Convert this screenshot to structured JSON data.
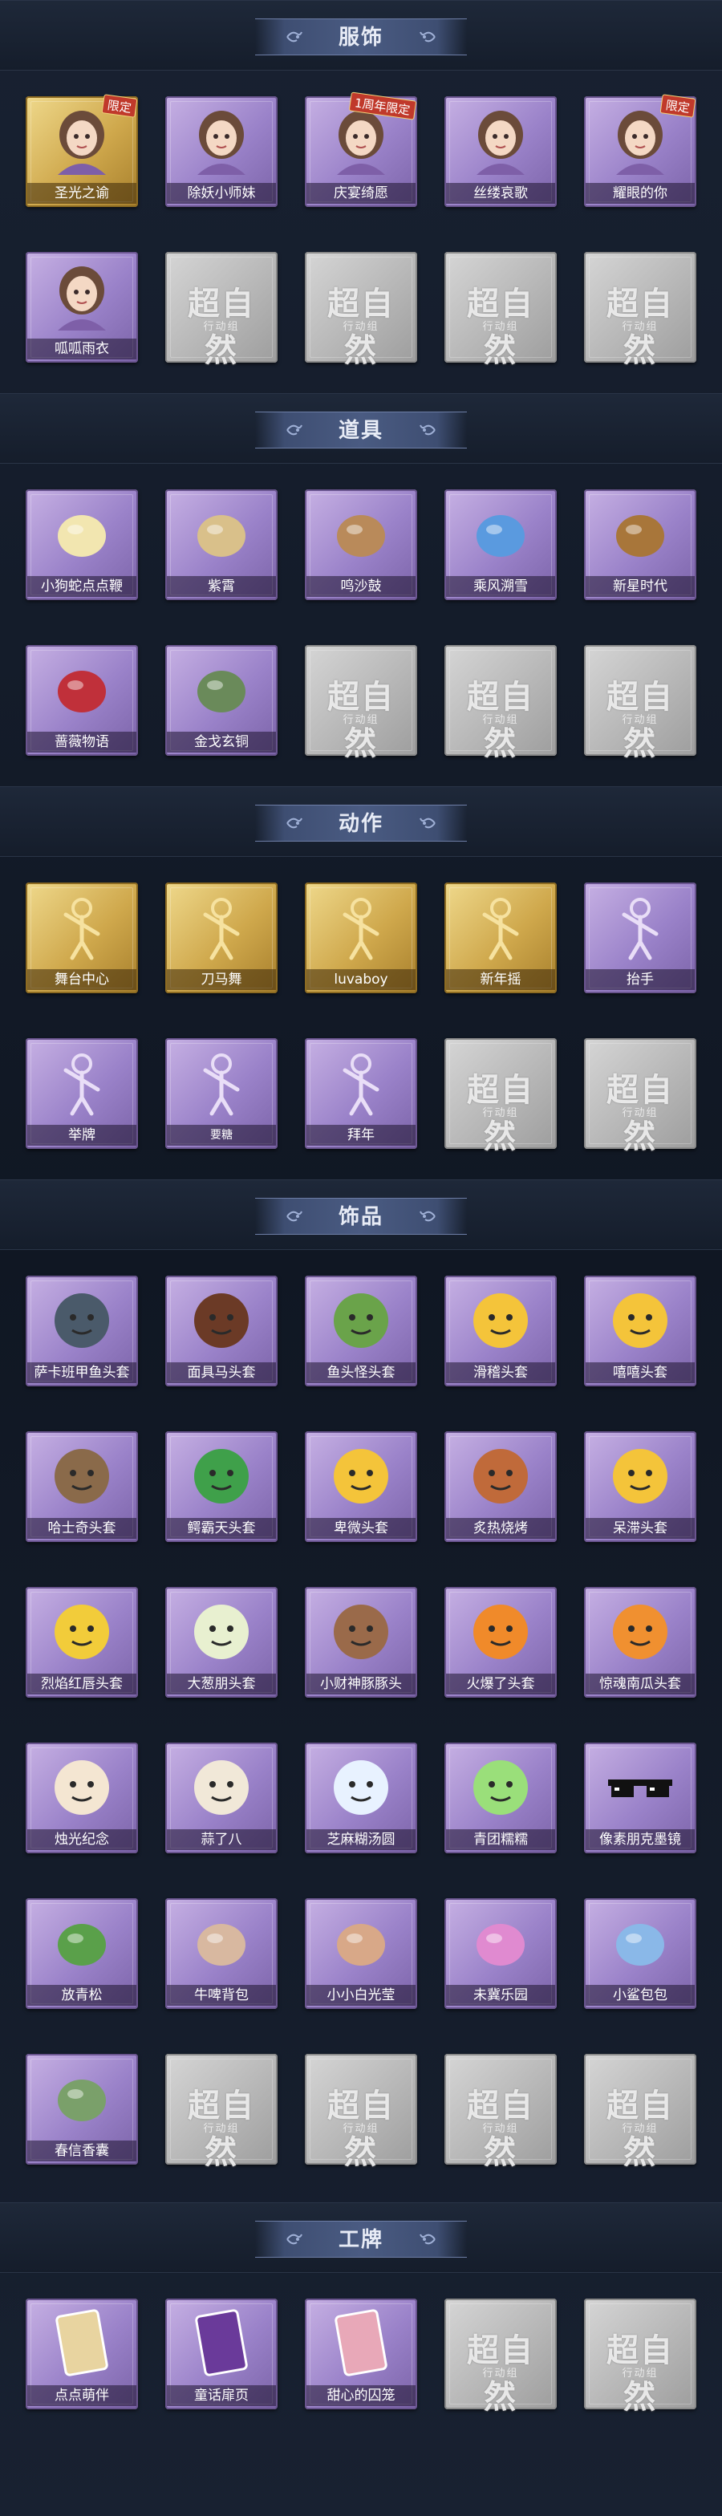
{
  "colors": {
    "background": "#121a27",
    "banner": "#4a5b82",
    "card_purple": "#9a82c9",
    "card_gold": "#cfa84c",
    "card_empty": "#b7b7b7"
  },
  "watermark": {
    "title": "超自然",
    "subtitle": "行动组"
  },
  "sections": [
    {
      "title": "服饰",
      "items": [
        {
          "label": "圣光之谕",
          "style": "gold",
          "tag": "限定",
          "icon": "character-portrait-icon"
        },
        {
          "label": "除妖小师妹",
          "style": "purple",
          "icon": "character-portrait-icon"
        },
        {
          "label": "庆宴绮愿",
          "style": "purple",
          "tag": "1周年限定",
          "icon": "character-portrait-icon"
        },
        {
          "label": "丝缕哀歌",
          "style": "purple",
          "icon": "character-portrait-icon"
        },
        {
          "label": "耀眼的你",
          "style": "purple",
          "tag": "限定",
          "icon": "character-portrait-icon"
        },
        {
          "label": "呱呱雨衣",
          "style": "purple",
          "icon": "character-portrait-icon"
        },
        {
          "style": "empty"
        },
        {
          "style": "empty"
        },
        {
          "style": "empty"
        },
        {
          "style": "empty"
        }
      ]
    },
    {
      "title": "道具",
      "items": [
        {
          "label": "小狗蛇点点鞭",
          "style": "purple",
          "icon": "snake-toy-icon"
        },
        {
          "label": "紫霄",
          "style": "purple",
          "icon": "pendant-icon"
        },
        {
          "label": "鸣沙鼓",
          "style": "purple",
          "icon": "drum-icon"
        },
        {
          "label": "乘风溯雪",
          "style": "purple",
          "icon": "wings-icon"
        },
        {
          "label": "新星时代",
          "style": "purple",
          "icon": "revolver-icon"
        },
        {
          "label": "蔷薇物语",
          "style": "purple",
          "icon": "first-aid-kit-icon"
        },
        {
          "label": "金戈玄铜",
          "style": "purple",
          "icon": "bronze-artifact-icon"
        },
        {
          "style": "empty"
        },
        {
          "style": "empty"
        },
        {
          "style": "empty"
        }
      ]
    },
    {
      "title": "动作",
      "items": [
        {
          "label": "舞台中心",
          "style": "gold",
          "icon": "pose-icon"
        },
        {
          "label": "刀马舞",
          "style": "gold",
          "icon": "pose-icon"
        },
        {
          "label": "luvaboy",
          "style": "gold",
          "icon": "pose-icon"
        },
        {
          "label": "新年摇",
          "style": "gold",
          "icon": "pose-icon"
        },
        {
          "label": "抬手",
          "style": "purple",
          "icon": "pose-icon"
        },
        {
          "label": "举牌",
          "style": "purple",
          "icon": "pose-icon"
        },
        {
          "label": "要糖",
          "style": "purple",
          "icon": "pose-icon",
          "small": true
        },
        {
          "label": "拜年",
          "style": "purple",
          "icon": "pose-icon"
        },
        {
          "style": "empty"
        },
        {
          "style": "empty"
        }
      ]
    },
    {
      "title": "饰品",
      "items": [
        {
          "label": "萨卡班甲鱼头套",
          "style": "purple",
          "icon": "fish-head-icon"
        },
        {
          "label": "面具马头套",
          "style": "purple",
          "icon": "horse-head-icon"
        },
        {
          "label": "鱼头怪头套",
          "style": "purple",
          "icon": "fish-monster-head-icon"
        },
        {
          "label": "滑稽头套",
          "style": "purple",
          "icon": "funny-face-icon"
        },
        {
          "label": "嘻嘻头套",
          "style": "purple",
          "icon": "grin-face-icon"
        },
        {
          "label": "哈士奇头套",
          "style": "purple",
          "icon": "husky-head-icon"
        },
        {
          "label": "鳄霸天头套",
          "style": "purple",
          "icon": "crocodile-head-icon"
        },
        {
          "label": "卑微头套",
          "style": "purple",
          "icon": "shy-face-icon"
        },
        {
          "label": "炙热烧烤",
          "style": "purple",
          "icon": "bbq-head-icon"
        },
        {
          "label": "呆滞头套",
          "style": "purple",
          "icon": "dazed-face-icon"
        },
        {
          "label": "烈焰红唇头套",
          "style": "purple",
          "icon": "pikachu-head-icon"
        },
        {
          "label": "大葱朋头套",
          "style": "purple",
          "icon": "scallion-head-icon"
        },
        {
          "label": "小财神豚豚头",
          "style": "purple",
          "icon": "capybara-head-icon"
        },
        {
          "label": "火爆了头套",
          "style": "purple",
          "icon": "fire-head-icon"
        },
        {
          "label": "惊魂南瓜头套",
          "style": "purple",
          "icon": "pumpkin-head-icon"
        },
        {
          "label": "烛光纪念",
          "style": "purple",
          "icon": "candle-head-icon"
        },
        {
          "label": "蒜了八",
          "style": "purple",
          "icon": "garlic-head-icon"
        },
        {
          "label": "芝麻糊汤圆",
          "style": "purple",
          "icon": "dumpling-head-icon"
        },
        {
          "label": "青团糯糯",
          "style": "purple",
          "icon": "green-ball-head-icon"
        },
        {
          "label": "像素朋克墨镜",
          "style": "purple",
          "icon": "pixel-sunglasses-icon"
        },
        {
          "label": "放青松",
          "style": "purple",
          "icon": "bonsai-pendant-icon"
        },
        {
          "label": "牛啤背包",
          "style": "purple",
          "icon": "cow-backpack-icon"
        },
        {
          "label": "小小白光莹",
          "style": "purple",
          "icon": "doll-pendant-icon"
        },
        {
          "label": "未冀乐园",
          "style": "purple",
          "icon": "fairy-pendant-icon"
        },
        {
          "label": "小鲨包包",
          "style": "purple",
          "icon": "shark-bag-icon"
        },
        {
          "label": "春信香囊",
          "style": "purple",
          "icon": "sachet-icon"
        },
        {
          "style": "empty"
        },
        {
          "style": "empty"
        },
        {
          "style": "empty"
        },
        {
          "style": "empty"
        }
      ]
    },
    {
      "title": "工牌",
      "items": [
        {
          "label": "点点萌伴",
          "style": "purple",
          "icon": "badge-card-icon"
        },
        {
          "label": "童话扉页",
          "style": "purple",
          "icon": "storybook-card-icon"
        },
        {
          "label": "甜心的囚笼",
          "style": "purple",
          "icon": "cage-card-icon"
        },
        {
          "style": "empty"
        },
        {
          "style": "empty"
        }
      ]
    }
  ]
}
